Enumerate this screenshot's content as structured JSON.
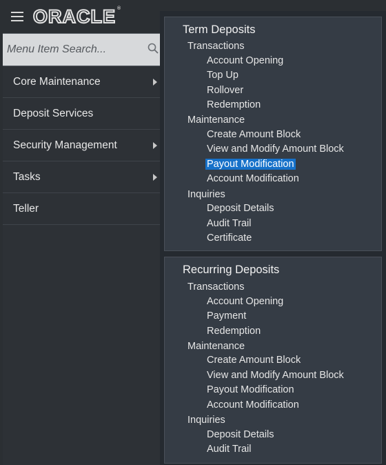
{
  "header": {
    "logo_text": "ORACLE",
    "logo_mark": "®"
  },
  "search": {
    "placeholder": "Menu Item Search..."
  },
  "nav": {
    "items": [
      {
        "label": "Core Maintenance",
        "has_submenu": true
      },
      {
        "label": "Deposit Services",
        "has_submenu": false
      },
      {
        "label": "Security Management",
        "has_submenu": true
      },
      {
        "label": "Tasks",
        "has_submenu": true
      },
      {
        "label": "Teller",
        "has_submenu": false
      }
    ]
  },
  "flyout": {
    "term": {
      "title": "Term Deposits",
      "transactions": {
        "label": "Transactions",
        "items": [
          "Account Opening",
          "Top Up",
          "Rollover",
          "Redemption"
        ]
      },
      "maintenance": {
        "label": "Maintenance",
        "items": [
          "Create Amount Block",
          "View and Modify Amount Block",
          "Payout Modification",
          "Account Modification"
        ]
      },
      "inquiries": {
        "label": "Inquiries",
        "items": [
          "Deposit Details",
          "Audit Trail",
          "Certificate"
        ]
      }
    },
    "recurring": {
      "title": "Recurring Deposits",
      "transactions": {
        "label": "Transactions",
        "items": [
          "Account Opening",
          "Payment",
          "Redemption"
        ]
      },
      "maintenance": {
        "label": "Maintenance",
        "items": [
          "Create Amount Block",
          "View and Modify Amount Block",
          "Payout Modification",
          "Account Modification"
        ]
      },
      "inquiries": {
        "label": "Inquiries",
        "items": [
          "Deposit Details",
          "Audit Trail"
        ]
      }
    }
  },
  "colors": {
    "highlight": "#1671c9",
    "panel": "#353c45",
    "nav": "#2d3136"
  }
}
